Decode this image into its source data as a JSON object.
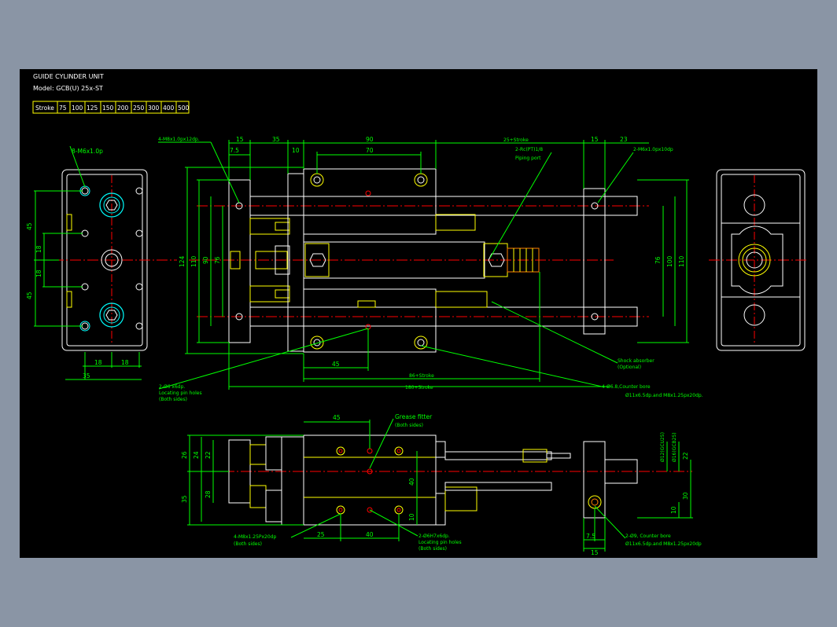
{
  "header": {
    "title": "GUIDE CYLINDER UNIT",
    "model": "Model: GCB(U) 25x-ST"
  },
  "stroke_table": {
    "label": "Stroke",
    "values": [
      "75",
      "100",
      "125",
      "150",
      "200",
      "250",
      "300",
      "400",
      "500"
    ]
  },
  "top_view": {
    "dims_top": [
      "15",
      "35",
      "10",
      "90",
      "25+Stroke",
      "15",
      "23",
      "7.5",
      "70"
    ],
    "dims_left": [
      "124",
      "110",
      "90",
      "76"
    ],
    "dims_right": [
      "76",
      "100",
      "110"
    ],
    "dims_bottom": [
      "45",
      "86+Stroke",
      "180+Stroke"
    ],
    "callout_tap_left": "4-M8x1.0px12dp.",
    "callout_port_line1": "2-Rc(PT)1/8",
    "callout_port_line2": "Piping port",
    "callout_tap_right": "2-M6x1.0px10dp",
    "callout_shock_line1": "Shock absorber",
    "callout_shock_line2": "(Optional)",
    "callout_pin_line1": "2-Ø6 x6dp.",
    "callout_pin_line2": "Locating pin holes",
    "callout_pin_line3": "(Both sides)",
    "callout_bore_line1": "4-Ø6.8,Counter bore",
    "callout_bore_line2": "Ø11x6.5dp.and M8x1.25px20dp."
  },
  "left_view": {
    "callout": "8-M6x1.0p",
    "dims_vertical": [
      "45",
      "18",
      "18",
      "45"
    ],
    "dims_bottom": [
      "18",
      "18",
      "35"
    ]
  },
  "front_view": {
    "dims_left_outer": [
      "26",
      "35"
    ],
    "dims_left_inner": [
      "24",
      "22",
      "28"
    ],
    "dims_right": [
      "40",
      "10"
    ],
    "dims_top": [
      "45"
    ],
    "dims_bottom": [
      "25",
      "40"
    ],
    "dims_end": [
      "Ø12(GCU25)",
      "Ø16(GCB25)",
      "22",
      "30",
      "10",
      "7.5",
      "15"
    ],
    "callout_grease_line1": "Grease fitter",
    "callout_grease_line2": "(Both sides)",
    "callout_tap_line1": "4-M8x1.25Px20dp",
    "callout_tap_line2": "(Both sides)",
    "callout_pin_line1": "2-Ø6H7x6dp.",
    "callout_pin_line2": "Locating pin holes",
    "callout_pin_line3": "(Both sides)",
    "callout_bore_line1": "2-Ø9, Counter bore",
    "callout_bore_line2": "Ø11x6.5dp.and M8x1.25px20dp"
  },
  "colors": {
    "background": "#000000",
    "frame": "#8a95a5",
    "outline": "#ffffff",
    "dimension": "#00ff00",
    "hidden": "#ffff00",
    "center": "#ff0000",
    "cyan": "#00ffff",
    "fitting": "#ff8000"
  }
}
